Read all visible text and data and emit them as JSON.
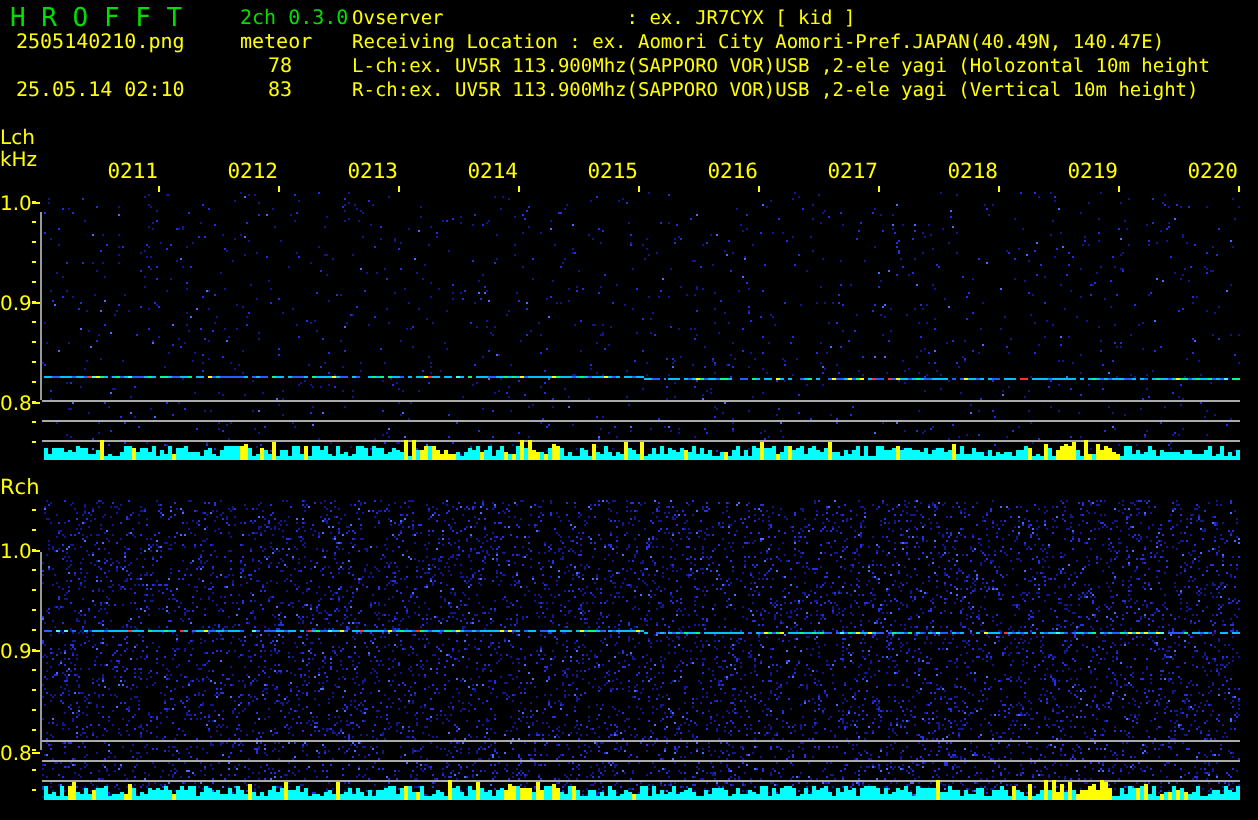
{
  "app": {
    "name": "H R O F F T",
    "version": "2ch 0.3.0"
  },
  "file": {
    "name": "2505140210.png",
    "datetime": "25.05.14 02:10"
  },
  "meteor": {
    "label": "meteor",
    "counts": [
      "78",
      "83"
    ]
  },
  "info_lines": [
    "Ovserver                : ex. JR7CYX [ kid ]",
    "Receiving Location : ex. Aomori City Aomori-Pref.JAPAN(40.49N, 140.47E)",
    "L-ch:ex. UV5R 113.900Mhz(SAPPORO VOR)USB ,2-ele yagi (Holozontal 10m height",
    "R-ch:ex. UV5R 113.900Mhz(SAPPORO VOR)USB ,2-ele yagi (Vertical 10m height)"
  ],
  "time_labels": [
    "0211",
    "0212",
    "0213",
    "0214",
    "0215",
    "0216",
    "0217",
    "0218",
    "0219",
    "0220"
  ],
  "channels": [
    {
      "label": "Lch",
      "unit": "kHz",
      "axis_labels": [
        "1.0",
        "0.9",
        "0.8"
      ]
    },
    {
      "label": "Rch",
      "axis_labels": [
        "1.0",
        "0.9",
        "0.8"
      ]
    }
  ]
}
